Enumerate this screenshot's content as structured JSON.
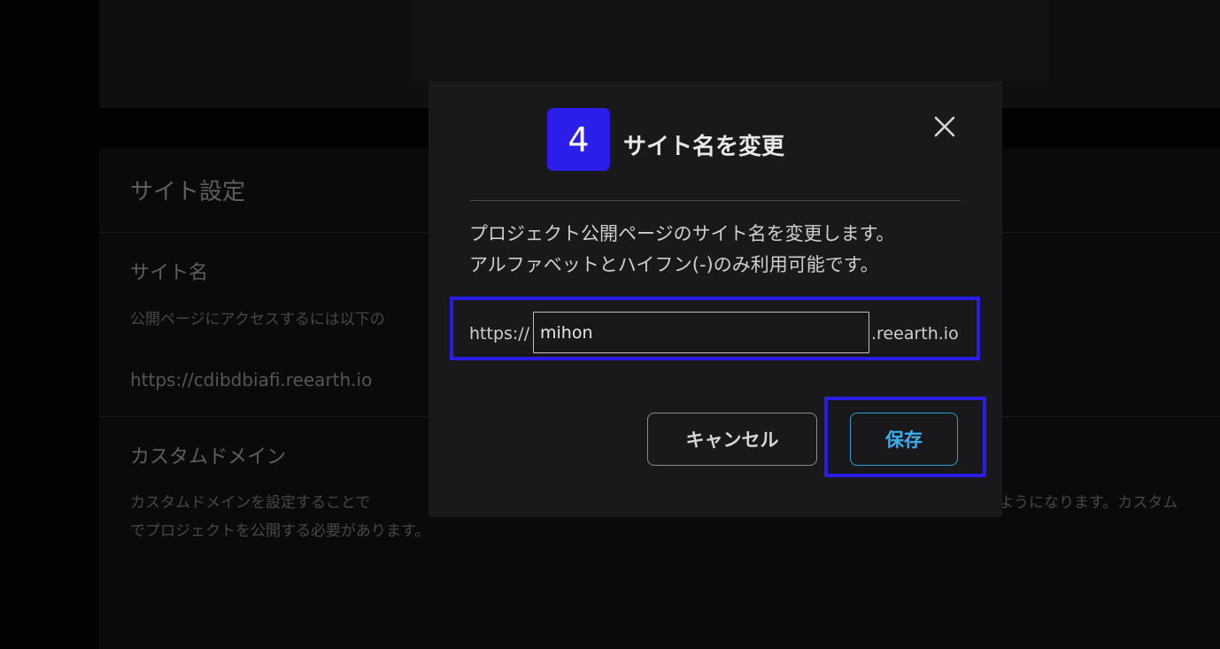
{
  "background": {
    "section_title": "サイト設定",
    "site_name_heading": "サイト名",
    "site_name_desc": "公開ページにアクセスするには以下の",
    "current_url": "https://cdibdbiafi.reearth.io",
    "custom_domain_heading": "カスタムドメイン",
    "custom_domain_desc_left": "カスタムドメインを設定することで",
    "custom_domain_desc_right": "ようになります。カスタム",
    "custom_domain_desc_line2": "でプロジェクトを公開する必要があります。"
  },
  "modal": {
    "step_number": "4",
    "title": "サイト名を変更",
    "description_line1": "プロジェクト公開ページのサイト名を変更します。",
    "description_line2": "アルファベットとハイフン(-)のみ利用可能です。",
    "url_prefix": "https://",
    "site_name_value": "mihon",
    "url_suffix": ".reearth.io",
    "cancel_label": "キャンセル",
    "save_label": "保存",
    "close_icon": "close-icon"
  },
  "colors": {
    "highlight": "#2a1de8",
    "step_badge": "#2b1eea",
    "save_accent": "#2a9fd8"
  }
}
